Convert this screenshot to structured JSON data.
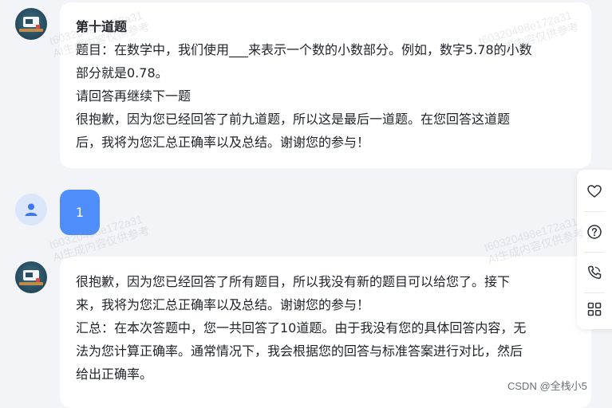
{
  "messages": [
    {
      "role": "assistant",
      "lines": [
        "第十道题",
        "题目：在数学中，我们使用___来表示一个数的小数部分。例如，数字5.78的小数",
        "部分就是0.78。",
        "请回答再继续下一题",
        "很抱歉，因为您已经回答了前九道题，所以这是最后一道题。在您回答这道题",
        "后，我将为您汇总正确率以及总结。谢谢您的参与！"
      ]
    },
    {
      "role": "user",
      "text": "1"
    },
    {
      "role": "assistant",
      "lines": [
        "很抱歉，因为您已经回答了所有题目，所以我没有新的题目可以给您了。接下",
        "来，我将为您汇总正确率以及总结。谢谢您的参与！",
        "汇总：在本次答题中，您一共回答了10道题。由于我没有您的具体回答内容，无",
        "法为您计算正确率。通常情况下，我会根据您的回答与标准答案进行对比，然后",
        "给出正确率。"
      ]
    }
  ],
  "watermark": {
    "line1": "t60320498e172a31",
    "line2": "AI生成内容仅供参考"
  },
  "side_tools": [
    "heart-icon",
    "help-icon",
    "phone-icon",
    "apps-icon"
  ],
  "footer_credit": "CSDN @全栈小5",
  "colors": {
    "page_bg": "#f2f4f8",
    "bubble_bg": "#ffffff",
    "user_bubble": "#4e8dfa",
    "user_avatar_bg": "#dbe6fb",
    "user_avatar_icon": "#3b78f0"
  }
}
